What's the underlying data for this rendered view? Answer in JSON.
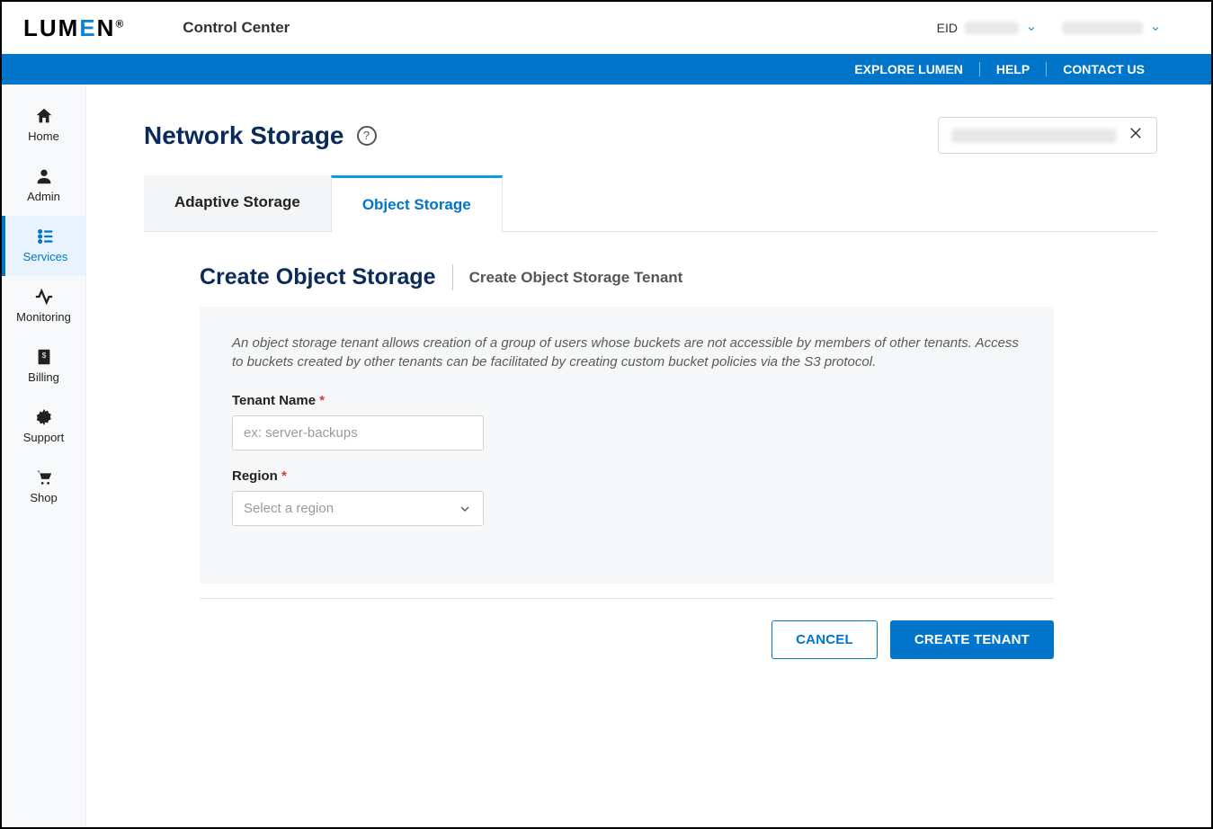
{
  "header": {
    "logo_pre": "LUM",
    "logo_blue": "E",
    "logo_post": "N",
    "app_title": "Control Center",
    "eid_label": "EID"
  },
  "bluebar": {
    "explore": "EXPLORE LUMEN",
    "help": "HELP",
    "contact": "CONTACT US"
  },
  "sidebar": {
    "home": "Home",
    "admin": "Admin",
    "services": "Services",
    "monitoring": "Monitoring",
    "billing": "Billing",
    "support": "Support",
    "shop": "Shop"
  },
  "page": {
    "title": "Network Storage",
    "help_glyph": "?"
  },
  "tabs": {
    "adaptive": "Adaptive Storage",
    "object": "Object Storage"
  },
  "section": {
    "title": "Create Object Storage",
    "subtitle": "Create Object Storage Tenant",
    "intro": "An object storage tenant allows creation of a group of users whose buckets are not accessible by members of other tenants. Access to buckets created by other tenants can be facilitated by creating custom bucket policies via the S3 protocol."
  },
  "form": {
    "tenant_label": "Tenant Name",
    "tenant_placeholder": "ex: server-backups",
    "region_label": "Region",
    "region_placeholder": "Select a region",
    "required_mark": "*"
  },
  "actions": {
    "cancel": "CANCEL",
    "create": "CREATE TENANT"
  }
}
